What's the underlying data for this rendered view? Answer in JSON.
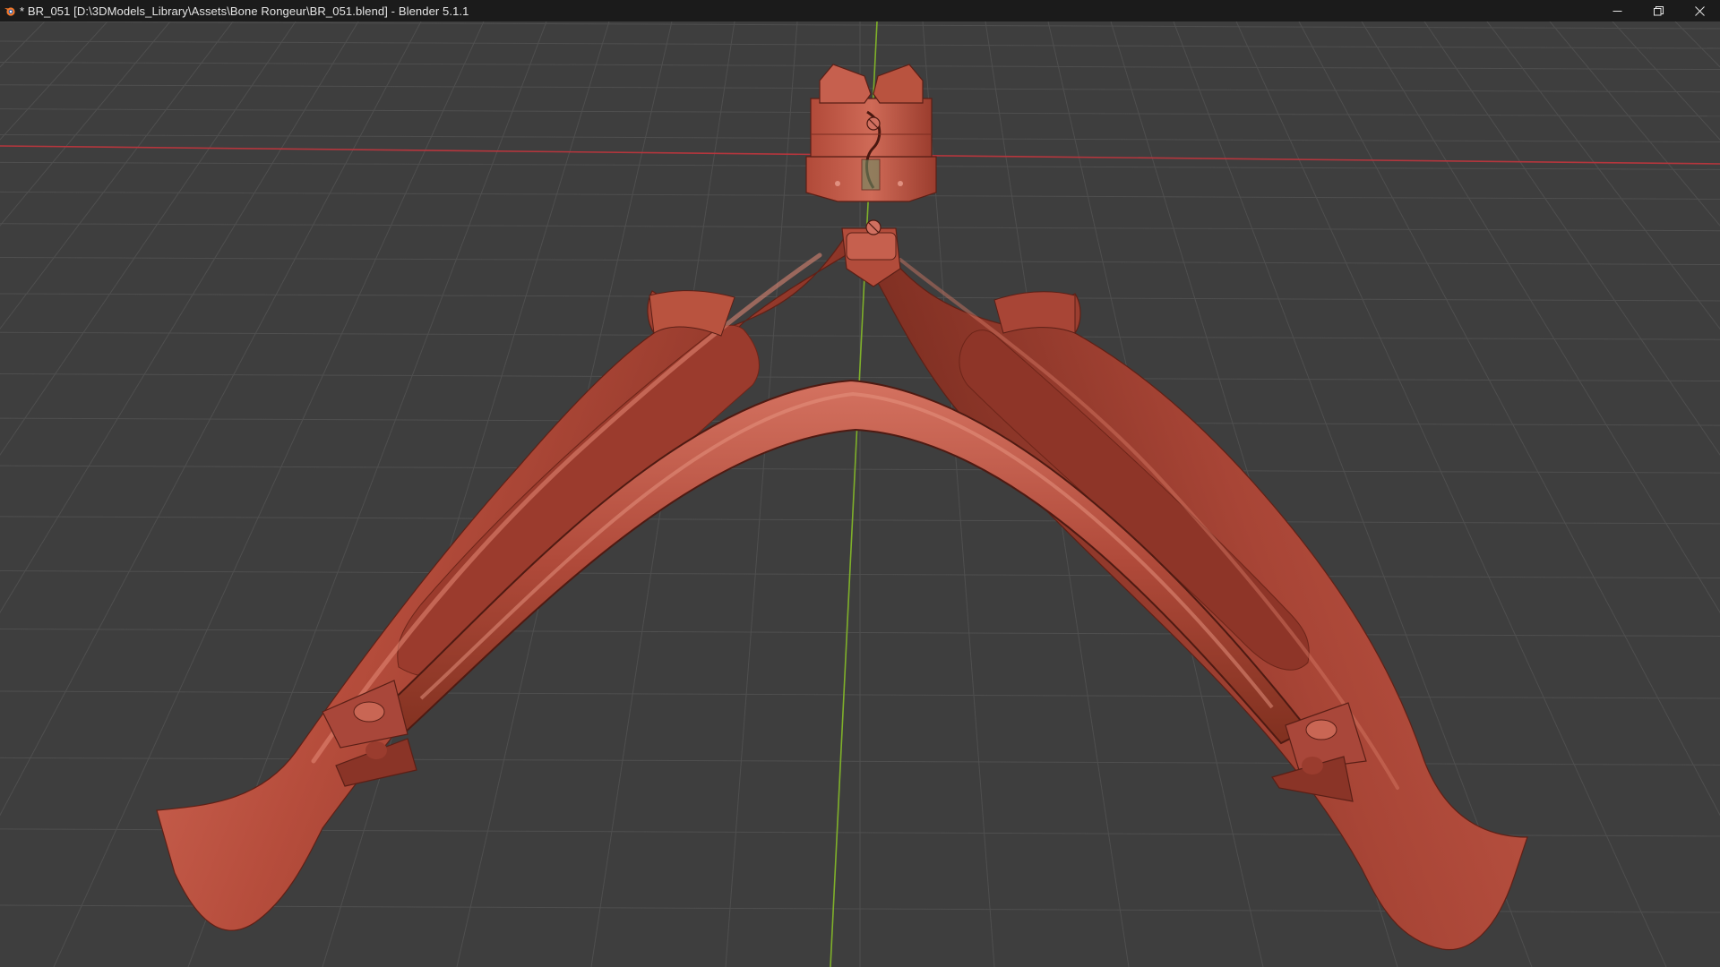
{
  "window": {
    "title": "* BR_051 [D:\\3DModels_Library\\Assets\\Bone Rongeur\\BR_051.blend] - Blender 5.1.1",
    "app_icon": "blender-logo-icon",
    "controls": {
      "minimize": "minimize-icon",
      "maximize": "restore-icon",
      "close": "close-icon"
    }
  },
  "viewport": {
    "background_color": "#3e3e3e",
    "grid_color": "#4f4f4f",
    "x_axis_color": "#b5363d",
    "y_axis_color": "#7fb02a",
    "model": {
      "object": "bone-rongeur",
      "shading": "solid",
      "material_color": "#b0493a",
      "highlight_color": "#d36a58",
      "shadow_color": "#6e2519"
    }
  }
}
